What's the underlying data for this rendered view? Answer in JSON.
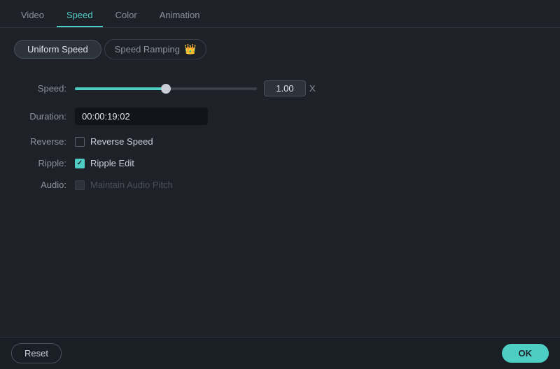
{
  "nav": {
    "tabs": [
      {
        "id": "video",
        "label": "Video"
      },
      {
        "id": "speed",
        "label": "Speed"
      },
      {
        "id": "color",
        "label": "Color"
      },
      {
        "id": "animation",
        "label": "Animation"
      }
    ],
    "active": "speed"
  },
  "subtabs": {
    "uniform": "Uniform Speed",
    "ramp": "Speed Ramping",
    "ramp_icon": "👑"
  },
  "form": {
    "speed_label": "Speed:",
    "speed_value": "1.00",
    "speed_x": "X",
    "speed_slider_percent": 50,
    "duration_label": "Duration:",
    "duration_value": "00:00:19:02",
    "reverse_label": "Reverse:",
    "reverse_checkbox_label": "Reverse Speed",
    "reverse_checked": false,
    "ripple_label": "Ripple:",
    "ripple_checkbox_label": "Ripple Edit",
    "ripple_checked": true,
    "audio_label": "Audio:",
    "audio_checkbox_label": "Maintain Audio Pitch",
    "audio_checked": false,
    "audio_disabled": true
  },
  "footer": {
    "reset_label": "Reset",
    "ok_label": "OK"
  }
}
